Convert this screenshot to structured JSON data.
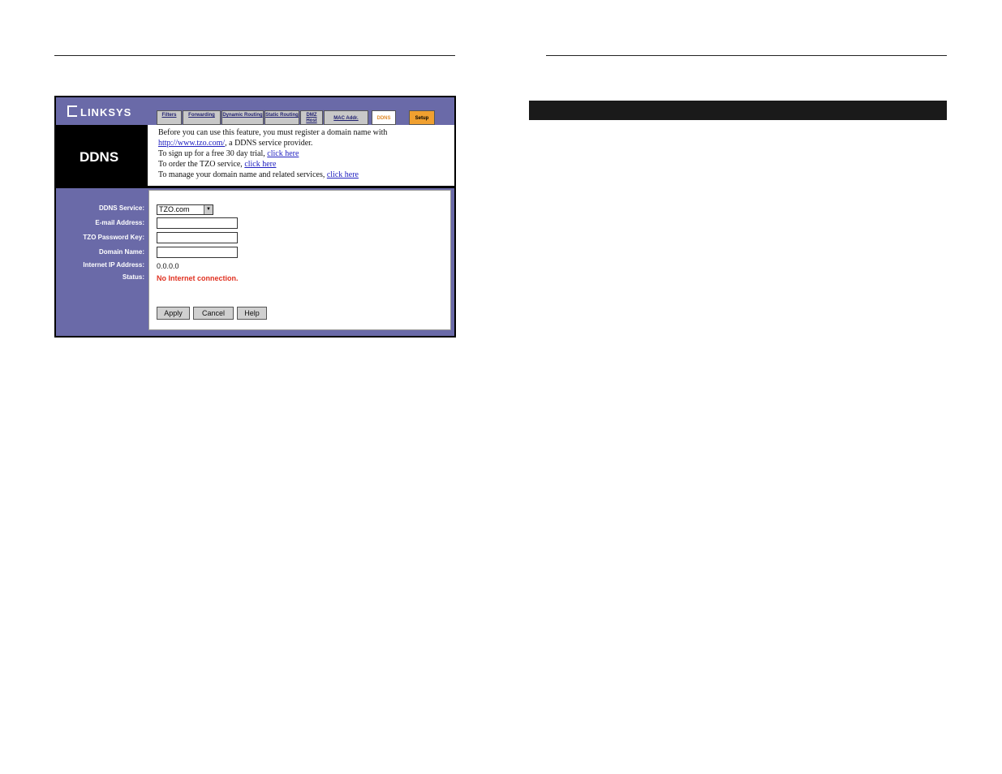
{
  "header": {
    "logo_text": "LINKSYS",
    "tabs": [
      {
        "label": "Filters"
      },
      {
        "label": "Forwarding"
      },
      {
        "label": "Dynamic Routing"
      },
      {
        "label": "Static Routing"
      },
      {
        "label": "DMZ Host"
      },
      {
        "label": "MAC Addr."
      },
      {
        "label": "DDNS"
      },
      {
        "label": "Setup"
      }
    ]
  },
  "page": {
    "title": "DDNS"
  },
  "info": {
    "line1": "Before you can use this feature, you must register a domain name with",
    "link_url": "http://www.tzo.com/",
    "line2_suffix": ", a DDNS service provider.",
    "line3_prefix": "To sign up for a free 30 day trial, ",
    "line4_prefix": "To order the TZO service, ",
    "line5_prefix": "To manage your domain name and related services, ",
    "click_here": "click here"
  },
  "form": {
    "labels": {
      "service": "DDNS Service:",
      "email": "E-mail Address:",
      "password": "TZO Password Key:",
      "domain": "Domain Name:",
      "ip": "Internet IP Address:",
      "status": "Status:"
    },
    "service_selected": "TZO.com",
    "email_value": "",
    "password_value": "",
    "domain_value": "",
    "ip_value": "0.0.0.0",
    "status_value": "No Internet connection."
  },
  "buttons": {
    "apply": "Apply",
    "cancel": "Cancel",
    "help": "Help"
  },
  "colors": {
    "frame": "#6a6aa8",
    "active_tab": "#e08a2a",
    "status_error": "#e03020",
    "link": "#2020c0"
  }
}
